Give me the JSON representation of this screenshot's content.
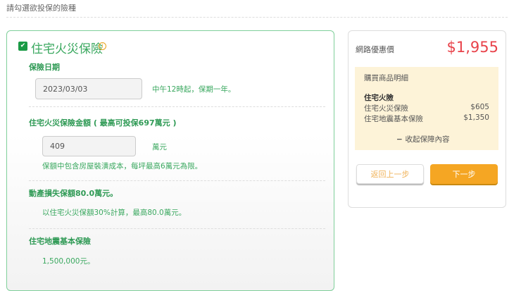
{
  "header": {
    "instruction": "請勾選欲投保的險種"
  },
  "product": {
    "title": "住宅火災保險",
    "checked": true,
    "date_label": "保險日期",
    "date_value": "2023/03/03",
    "date_note": "中午12時起，保期一年。",
    "amount_label": "住宅火災保險金額 ( 最高可投保697萬元 )",
    "amount_value": "409",
    "amount_unit": "萬元",
    "amount_note": "保額中包含房屋裝潢成本，每坪最高6萬元為限。",
    "movable_label": "動產損失保額80.0萬元。",
    "movable_note": "以住宅火災保額30%計算，最高80.0萬元。",
    "quake_label": "住宅地震基本保險",
    "quake_value": "1,500,000元。"
  },
  "summary": {
    "price_label": "網路優惠價",
    "price": "$1,955",
    "detail_title": "購買商品明細",
    "group": "住宅火險",
    "items": [
      {
        "name": "住宅火災保險",
        "price": "$605"
      },
      {
        "name": "住宅地震基本保險",
        "price": "$1,350"
      }
    ],
    "collapse": "收起保障內容",
    "back": "返回上一步",
    "next": "下一步"
  },
  "colors": {
    "green": "#3aa85f",
    "price": "#e8424a",
    "orange": "#f5a623"
  }
}
